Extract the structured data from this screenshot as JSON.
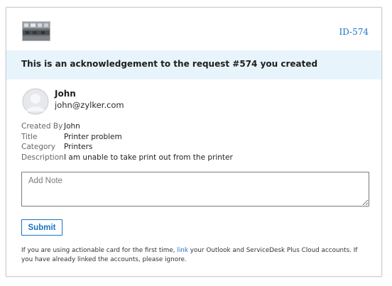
{
  "header": {
    "ticket_id": "ID-574",
    "thumbnail_icon": "office-photo-icon"
  },
  "banner": {
    "text": "This is an acknowledgement to the request #574 you created"
  },
  "requester": {
    "avatar_icon": "user-avatar-icon",
    "name": "John",
    "email": "john@zylker.com"
  },
  "details": [
    {
      "label": "Created By",
      "value": "John"
    },
    {
      "label": "Title",
      "value": "Printer problem"
    },
    {
      "label": "Category",
      "value": "Printers"
    },
    {
      "label": "Description",
      "value": "I am unable to take print out from the printer"
    }
  ],
  "note": {
    "placeholder": "Add Note",
    "value": ""
  },
  "actions": {
    "submit_label": "Submit"
  },
  "footer": {
    "text_before": "If you are using actionable card for the first time, ",
    "link_text": "link",
    "text_after": " your Outlook and ServiceDesk Plus Cloud accounts. If you have already linked the accounts, please ignore."
  },
  "colors": {
    "accent": "#1a73c8",
    "banner_bg": "#e8f4fc",
    "border": "#cfcfcf"
  }
}
